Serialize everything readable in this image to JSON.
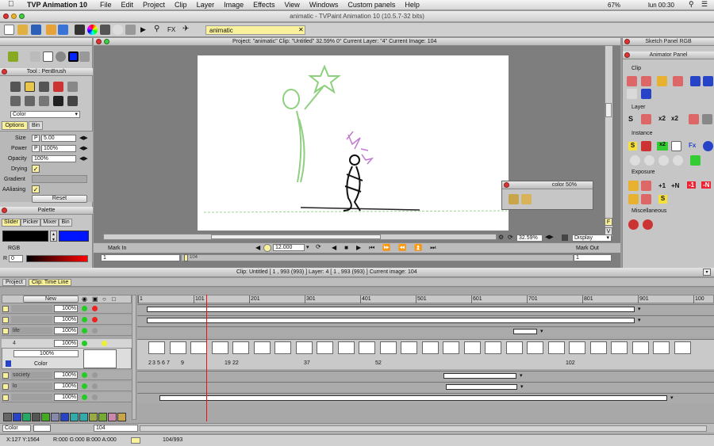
{
  "menubar": {
    "app": "TVP Animation 10",
    "items": [
      "File",
      "Edit",
      "Project",
      "Clip",
      "Layer",
      "Image",
      "Effects",
      "View",
      "Windows",
      "Custom panels",
      "Help"
    ],
    "battery": "67%",
    "clock": "lun 00:30"
  },
  "window_title": "animatic - TVPaint Animation 10 (10.5.7-32 bits)",
  "toolbar": {
    "tab_label": "animatic"
  },
  "tool_panel": {
    "title": "Tool : PenBrush",
    "color_mode": "Color",
    "tabs": [
      "Options",
      "Bin"
    ],
    "rows": [
      {
        "label": "Size",
        "flag": "P",
        "value": "5.00"
      },
      {
        "label": "Power",
        "flag": "P",
        "value": "100%"
      },
      {
        "label": "Opacity",
        "flag": "",
        "value": "100%"
      }
    ],
    "drying": "Drying",
    "gradient": "Gradient",
    "aaliasing": "AAliasing",
    "reset": "Reset"
  },
  "palette": {
    "title": "Palette",
    "tabs": [
      "Slider",
      "Picker",
      "Mixer",
      "Bin"
    ],
    "rgb_label": "RGB",
    "r_label": "R",
    "r_value": "0",
    "primary_color": "#000000",
    "secondary_color": "#0015ff"
  },
  "view": {
    "info": "Project: \"animatic\"  Clip: \"Untitled\"  32.59%  0°  Current Layer: \"4\"  Current Image: 104",
    "color_panel": "color 50%",
    "zoom": "32.59%",
    "display": "Display",
    "fps": "12.000",
    "mark_in": "Mark In",
    "mark_out": "Mark Out",
    "in_value": "1",
    "out_value": "1",
    "scrub_label": "104"
  },
  "right_panel": {
    "title1": "Sketch Panel RGB",
    "title2": "Animator Panel",
    "sections": [
      "Clip",
      "Layer",
      "Instance",
      "Exposure",
      "Miscellaneous"
    ],
    "x2a": "x2",
    "x2b": "x2",
    "x2c": "x2",
    "p1": "+1",
    "pn": "+N",
    "m1": "-1",
    "mn": "-N",
    "s": "S",
    "fx": "Fx"
  },
  "timeline": {
    "tabs": [
      "Project",
      "Clip: Time Line"
    ],
    "info": "Clip: Untitled [ 1 , 993  (993) ]    Layer: 4 [ 1 , 993  (993) ]    Current image: 104",
    "new_label": "New",
    "ruler": [
      "1",
      "101",
      "201",
      "301",
      "401",
      "501",
      "601",
      "701",
      "801",
      "901",
      "100"
    ],
    "layers": [
      {
        "name": "",
        "opacity": "100%"
      },
      {
        "name": "",
        "opacity": "100%"
      },
      {
        "name": "life",
        "opacity": "100%"
      },
      {
        "name": "4",
        "opacity": "100%"
      },
      {
        "name": "society",
        "opacity": "100%"
      },
      {
        "name": "lo",
        "opacity": "100%"
      },
      {
        "name": "",
        "opacity": "100%"
      }
    ],
    "current_opacity": "100%",
    "color_label": "Color",
    "frame_numbers": [
      "2",
      "3",
      "5",
      "6",
      "7",
      "9",
      "19",
      "22",
      "37",
      "52",
      "102"
    ],
    "bottom_color": "Color",
    "bottom_value": "104"
  },
  "statusbar": {
    "coords": "X:127  Y:1564",
    "rgba": "R:000 G:000 B:000 A:000",
    "frames": "104/993"
  }
}
